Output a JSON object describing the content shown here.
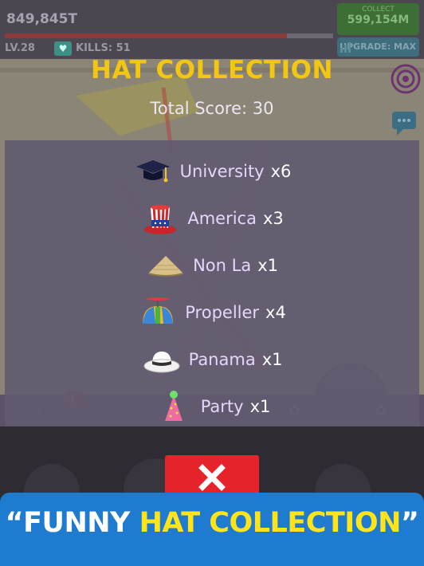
{
  "game_hud": {
    "money": "849,845T",
    "level": "LV.28",
    "kills_label": "KILLS",
    "kills_value": "51",
    "collect_label": "COLLECT",
    "collect_value": "599,154M",
    "upgrade_label": "UPGRADE: MAX",
    "hp_fraction": 0.86
  },
  "modal": {
    "title": "HAT COLLECTION",
    "total_score": "Total Score: 30",
    "hats": [
      {
        "name": "University",
        "count": "x6",
        "icon": "graduation-cap-icon"
      },
      {
        "name": "America",
        "count": "x3",
        "icon": "uncle-sam-hat-icon"
      },
      {
        "name": "Non La",
        "count": "x1",
        "icon": "conical-hat-icon"
      },
      {
        "name": "Propeller",
        "count": "x4",
        "icon": "propeller-cap-icon"
      },
      {
        "name": "Panama",
        "count": "x1",
        "icon": "panama-hat-icon"
      },
      {
        "name": "Party",
        "count": "x1",
        "icon": "party-hat-icon"
      }
    ],
    "close_icon": "close-icon"
  },
  "promo": {
    "prefix": "“FUNNY ",
    "highlight": "HAT COLLECTION",
    "suffix": "”"
  },
  "colors": {
    "title": "#f3c613",
    "close_button": "#e6222a",
    "banner": "#1f7bd0",
    "banner_highlight": "#ffe41a"
  }
}
